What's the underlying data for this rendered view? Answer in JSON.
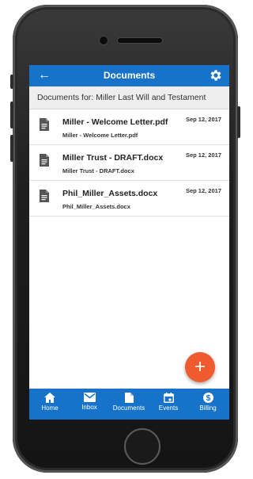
{
  "header": {
    "title": "Documents"
  },
  "subheader": {
    "text": "Documents for: Miller Last Will and Testament"
  },
  "documents": [
    {
      "name": "Miller - Welcome Letter.pdf",
      "file": "Miller - Welcome Letter.pdf",
      "date": "Sep 12, 2017"
    },
    {
      "name": "Miller Trust - DRAFT.docx",
      "file": "Miller Trust - DRAFT.docx",
      "date": "Sep 12, 2017"
    },
    {
      "name": "Phil_Miller_Assets.docx",
      "file": "Phil_Miller_Assets.docx",
      "date": "Sep 12, 2017"
    }
  ],
  "fab": {
    "label": "+"
  },
  "nav": [
    {
      "label": "Home",
      "icon": "home-icon"
    },
    {
      "label": "Inbox",
      "icon": "mail-icon"
    },
    {
      "label": "Documents",
      "icon": "document-icon"
    },
    {
      "label": "Events",
      "icon": "calendar-icon"
    },
    {
      "label": "Billing",
      "icon": "dollar-icon"
    }
  ],
  "colors": {
    "primary": "#1673c9",
    "fab": "#ef5a2f"
  }
}
